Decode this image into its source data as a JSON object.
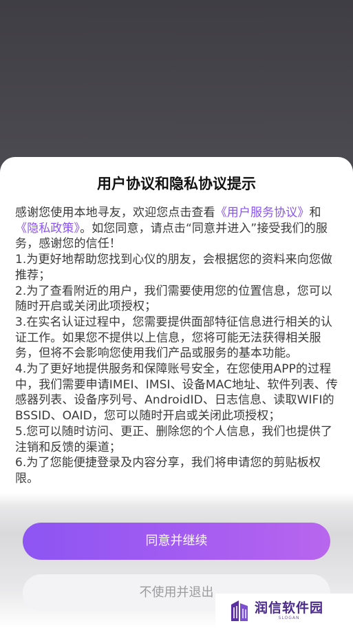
{
  "dialog": {
    "title": "用户协议和隐私协议提示",
    "intro_pre": "感谢您使用本地寻友，欢迎您点击查看",
    "link_user_agreement": "《用户服务协议》",
    "intro_and": "和",
    "link_privacy_policy": "《隐私政策》",
    "intro_post": "。如您同意，请点击“同意并进入”接受我们的服务，感谢您的信任！",
    "items": [
      "1.为更好地帮助您找到心仪的朋友，会根据您的资料来向您做推荐；",
      "2.为了查看附近的用户，我们需要使用您的位置信息，您可以随时开启或关闭此项授权；",
      "3.在实名认证过程中，您需要提供面部特征信息进行相关的认证工作。如果您不提供以上信息，您将可能无法获得相关服务，但将不会影响您使用我们产品或服务的基本功能。",
      "4.为了更好地提供服务和保障账号安全，在您使用APP的过程中，我们需要申请IMEI、IMSI、设备MAC地址、软件列表、传感器列表、设备序列号、AndroidID、日志信息、读取WIFI的BSSID、OAID，您可以随时开启或关闭此项授权；",
      "5.您可以随时访问、更正、删除您的个人信息，我们也提供了注销和反馈的渠道；",
      "6.为了您能便捷登录及内容分享，我们将申请您的剪贴板权限。"
    ],
    "agree_button": "同意并继续",
    "exit_button": "不使用并退出"
  },
  "watermark": {
    "name": "润信软件园",
    "slogan": "SLOGAN",
    "logo_icon": "building-logo-icon"
  },
  "colors": {
    "accent": "#8a55ee",
    "button_gradient_start": "#8d55f3",
    "button_gradient_end": "#b866ee",
    "backdrop": "#4a494f"
  }
}
